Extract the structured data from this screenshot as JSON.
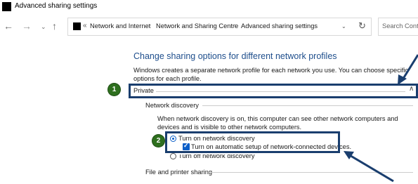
{
  "window": {
    "title": "Advanced sharing settings"
  },
  "nav": {
    "back_icon": "←",
    "forward_icon": "→",
    "history_icon": "⌄",
    "up_icon": "↑"
  },
  "address_bar": {
    "overflow": "«",
    "crumbs": [
      "Network and Internet",
      "Network and Sharing Centre",
      "Advanced sharing settings"
    ],
    "separator": "›",
    "dropdown_icon": "⌄",
    "refresh_icon": "↻"
  },
  "search": {
    "placeholder": "Search Contr"
  },
  "content": {
    "heading": "Change sharing options for different network profiles",
    "description": "Windows creates a separate network profile for each network you use. You can choose specific options for each profile.",
    "profile": {
      "label": "Private",
      "chevron": "∧"
    },
    "network_discovery": {
      "label": "Network discovery",
      "description": "When network discovery is on, this computer can see other network computers and devices and is visible to other network computers.",
      "option_on": "Turn on network discovery",
      "auto_setup": "Turn on automatic setup of network-connected devices.",
      "option_off": "Turn off network discovery",
      "selected": "on",
      "auto_setup_checked": true
    },
    "file_printer_sharing": {
      "label": "File and printer sharing"
    }
  },
  "annotations": {
    "badge1": "1",
    "badge2": "2",
    "box_color": "#1a3e6e",
    "badge_color": "#2e6f1e",
    "arrow_color": "#1a3e6e"
  }
}
